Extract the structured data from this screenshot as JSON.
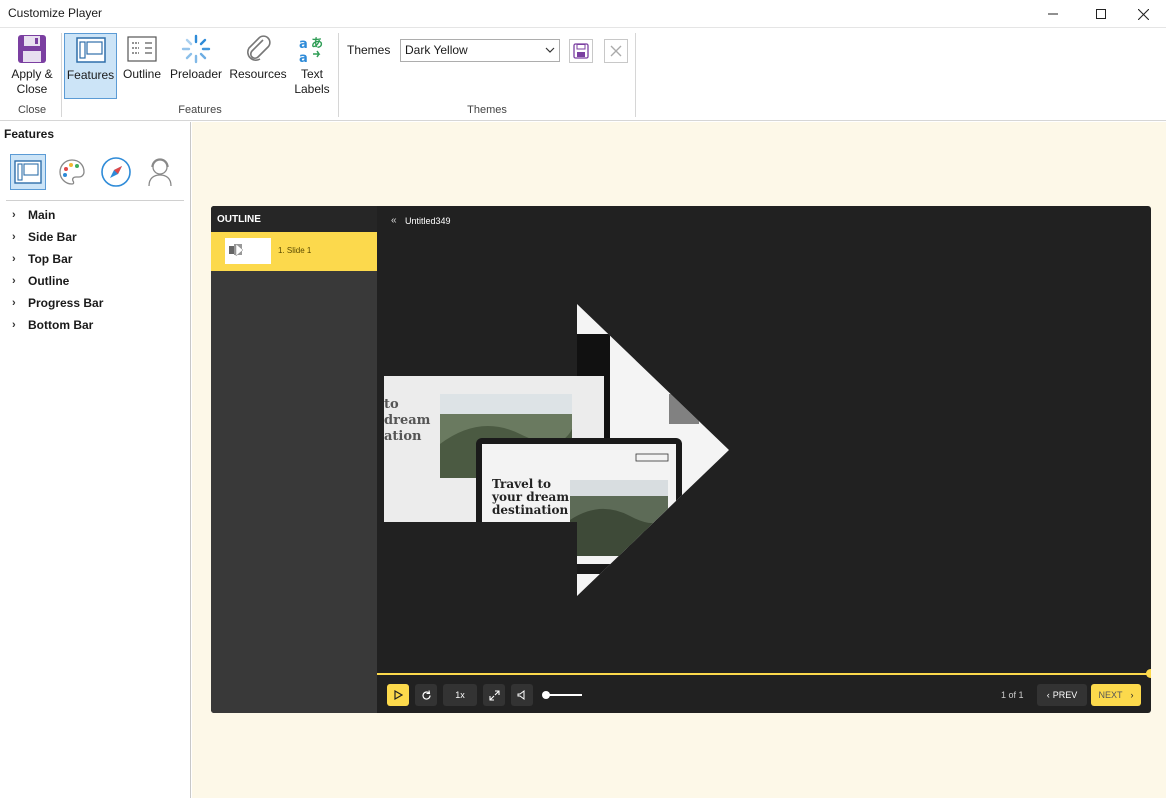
{
  "window": {
    "title": "Customize Player"
  },
  "ribbon": {
    "apply_close": "Apply & Close",
    "apply_close_l1": "Apply &",
    "apply_close_l2": "Close",
    "group_close": "Close",
    "features": "Features",
    "outline": "Outline",
    "preloader": "Preloader",
    "resources": "Resources",
    "text_labels_l1": "Text",
    "text_labels_l2": "Labels",
    "group_features": "Features",
    "themes_label": "Themes",
    "themes_value": "Dark Yellow",
    "group_themes": "Themes"
  },
  "left_panel": {
    "heading": "Features",
    "tree": [
      "Main",
      "Side Bar",
      "Top Bar",
      "Outline",
      "Progress Bar",
      "Bottom Bar"
    ]
  },
  "player": {
    "outline_title": "OUTLINE",
    "slide_item": "1. Slide 1",
    "slide_title": "Untitled349",
    "speed": "1x",
    "page_count": "1 of 1",
    "prev": "PREV",
    "next": "NEXT",
    "slide_text_large": "Travel to your dream destination",
    "slide_text_partial": "to dream ation"
  },
  "colors": {
    "accent_yellow": "#fcd94c",
    "player_bg": "#212121",
    "canvas_bg": "#fdf8e8",
    "ribbon_select": "#cce4f7"
  }
}
